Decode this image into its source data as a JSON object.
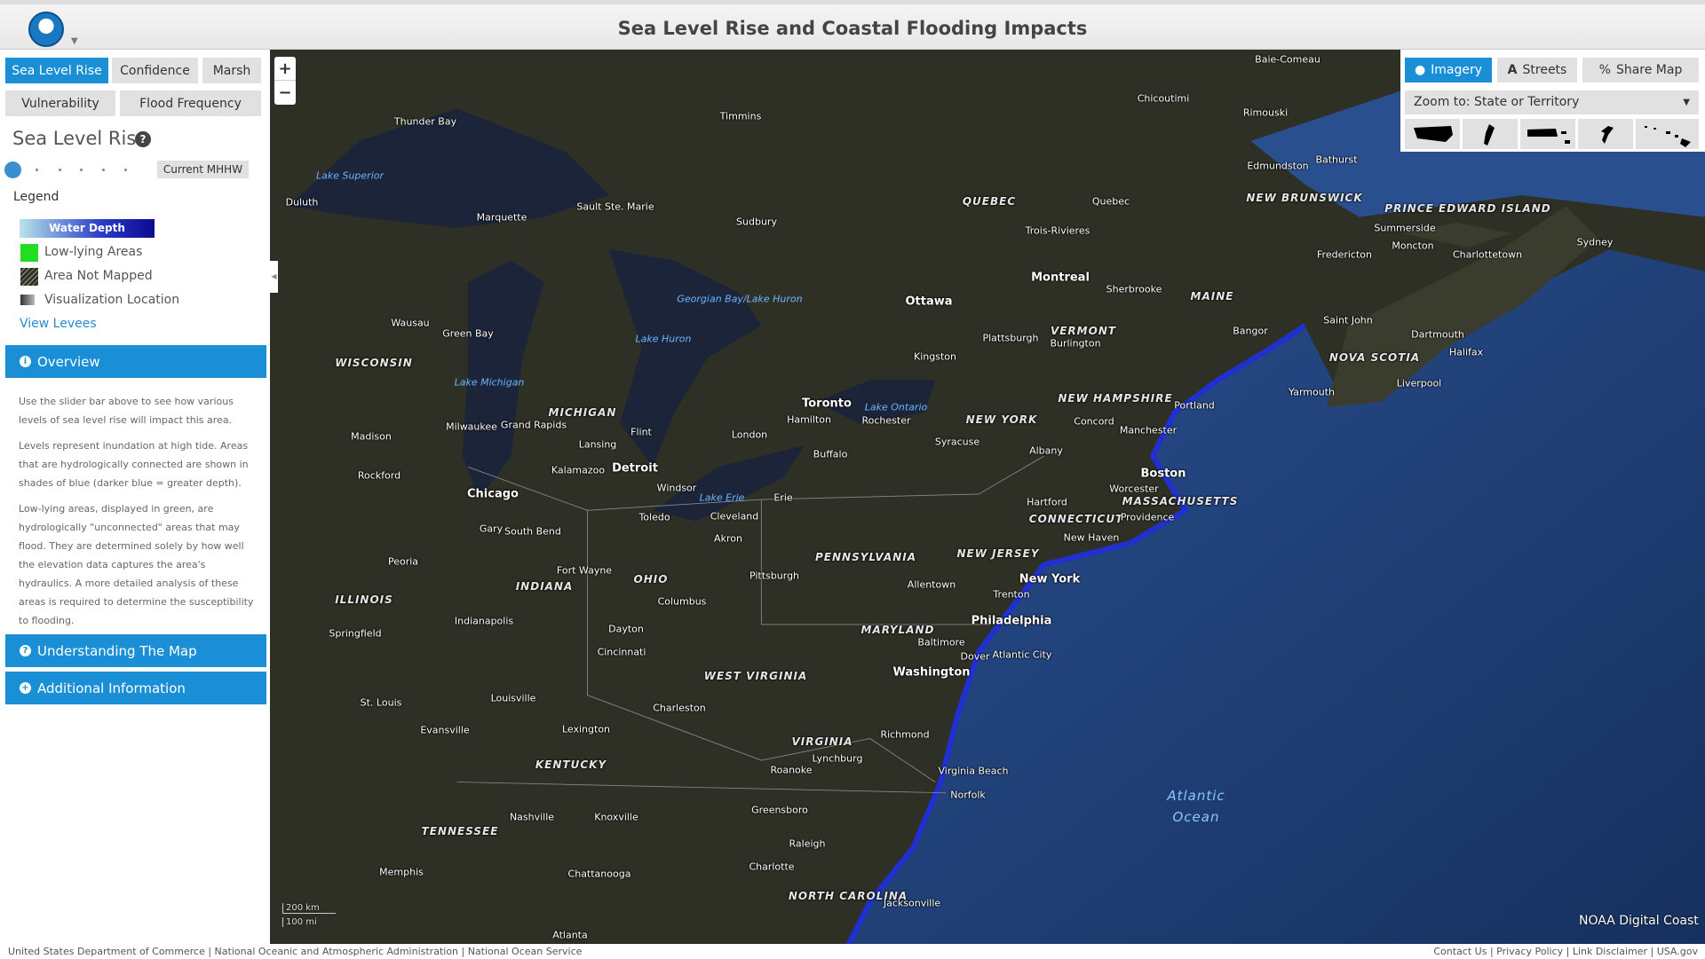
{
  "header": {
    "title": "Sea Level Rise and Coastal Flooding Impacts",
    "logo": "NOAA"
  },
  "tabs": [
    "Sea Level Rise",
    "Confidence",
    "Marsh",
    "Vulnerability",
    "Flood Frequency"
  ],
  "panel": {
    "title": "Sea Level Rise",
    "slider": {
      "level_index": 0,
      "steps": 7,
      "current_label": "Current MHHW"
    },
    "legend": {
      "title": "Legend",
      "water_depth": "Water Depth",
      "low_lying": "Low-lying Areas",
      "not_mapped": "Area Not Mapped",
      "viz_location": "Visualization Location",
      "view_levees": "View Levees"
    },
    "overview": {
      "title": "Overview",
      "paragraphs": [
        "Use the slider bar above to see how various levels of sea level rise will impact this area.",
        "Levels represent inundation at high tide. Areas that are hydrologically connected are shown in shades of blue (darker blue = greater depth).",
        "Low-lying areas, displayed in green, are hydrologically \"unconnected\" areas that may flood. They are determined solely by how well the elevation data captures the area's hydraulics. A more detailed analysis of these areas is required to determine the susceptibility to flooding."
      ]
    },
    "understanding": "Understanding The Map",
    "additional": "Additional Information"
  },
  "map_controls": {
    "zoom_in": "+",
    "zoom_out": "−",
    "imagery": "Imagery",
    "streets": "Streets",
    "share": "Share Map",
    "zoom_to": "Zoom to: State or Territory",
    "regions": [
      "continental-us-icon",
      "alaska-icon",
      "puerto-rico-icon",
      "guam-icon",
      "hawaii-icon"
    ]
  },
  "map": {
    "attribution": "NOAA Digital Coast",
    "scale_km": "200 km",
    "scale_mi": "100 mi",
    "states": [
      "WISCONSIN",
      "MICHIGAN",
      "ILLINOIS",
      "INDIANA",
      "OHIO",
      "PENNSYLVANIA",
      "NEW YORK",
      "WEST VIRGINIA",
      "VIRGINIA",
      "KENTUCKY",
      "TENNESSEE",
      "NORTH CAROLINA",
      "MARYLAND",
      "QUEBEC",
      "MAINE",
      "VERMONT",
      "NEW HAMPSHIRE",
      "MASSACHUSETTS",
      "CONNECTICUT",
      "NEW JERSEY",
      "NEW BRUNSWICK",
      "NOVA SCOTIA",
      "PRINCE EDWARD ISLAND"
    ],
    "major_cities": [
      "Chicago",
      "Detroit",
      "Toronto",
      "Montreal",
      "Boston",
      "New York",
      "Philadelphia",
      "Washington",
      "Ottawa"
    ],
    "cities": [
      "Pittsburgh",
      "Cleveland",
      "Columbus",
      "Indianapolis",
      "Cincinnati",
      "Louisville",
      "Nashville",
      "Charlotte",
      "Richmond",
      "Norfolk",
      "Virginia Beach",
      "Baltimore",
      "Buffalo",
      "Rochester",
      "Syracuse",
      "Albany",
      "Hartford",
      "Providence",
      "Portland",
      "Bangor",
      "Quebec",
      "Halifax",
      "Sydney",
      "Milwaukee",
      "Madison",
      "Duluth",
      "Thunder Bay",
      "Sault Ste. Marie",
      "Lansing",
      "Flint",
      "Kingston",
      "Erie",
      "Atlantic City",
      "Dover",
      "Trenton",
      "Raleigh",
      "Greensboro",
      "Memphis",
      "Atlanta",
      "Charleston",
      "Lexington",
      "Springfield",
      "Peoria",
      "St. Louis",
      "Jacksonville",
      "Chattanooga",
      "Knoxville",
      "Roanoke",
      "Lynchburg",
      "Fredericton",
      "Saint John",
      "Moncton",
      "Charlottetown",
      "Summerside",
      "Rimouski",
      "Chicoutimi",
      "Baie-Comeau",
      "Timmins",
      "Sudbury",
      "Trois-Rivieres",
      "Sherbrooke",
      "Burlington",
      "Plattsburgh",
      "Concord",
      "Manchester",
      "Worcester",
      "New Haven",
      "Allentown",
      "Hamilton",
      "London",
      "Windsor",
      "Toledo",
      "Akron",
      "Dayton",
      "Fort Wayne",
      "South Bend",
      "Gary",
      "Rockford",
      "Kalamazoo",
      "Grand Rapids",
      "Marquette",
      "Green Bay",
      "Wausau",
      "Evansville",
      "Yarmouth",
      "Liverpool",
      "Dartmouth",
      "Edmundston",
      "Bathurst"
    ],
    "water": [
      "Lake Superior",
      "Lake Michigan",
      "Lake Huron",
      "Lake Ontario",
      "Lake Erie",
      "Georgian Bay/Lake Huron"
    ],
    "ocean": [
      "Atlantic",
      "Ocean"
    ]
  },
  "footer": {
    "left": "United States Department of Commerce | National Oceanic and Atmospheric Administration | National Ocean Service",
    "right": "Contact Us | Privacy Policy | Link Disclaimer | USA.gov"
  },
  "colors": {
    "accent": "#1a8fd6",
    "low_lying": "#22dd22",
    "water_deep": "#0a0a90",
    "ocean": "#1d3f7c",
    "land": "#2e3025"
  }
}
